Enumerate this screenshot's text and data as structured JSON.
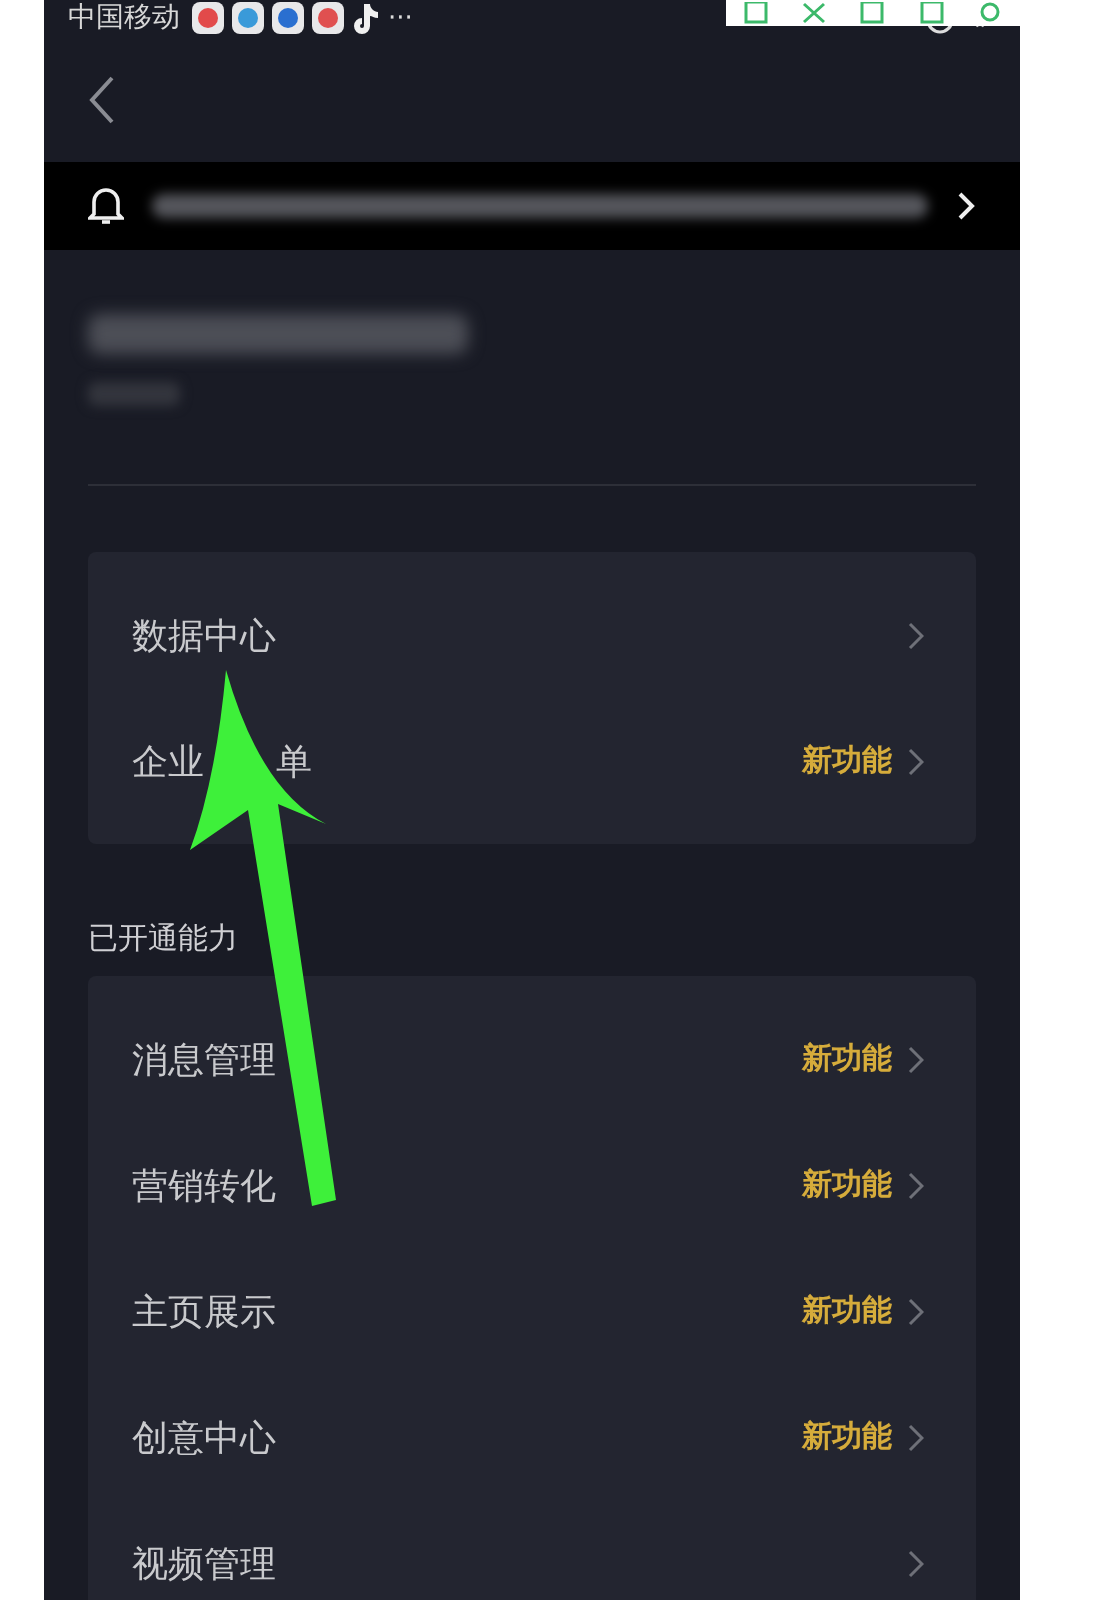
{
  "status_bar": {
    "carrier": "中国移动",
    "more": "···"
  },
  "section_title": "已开通能力",
  "primary_items": [
    {
      "label": "数据中心"
    },
    {
      "label_parts": [
        "企业",
        "单"
      ],
      "badge": "新功能"
    }
  ],
  "capabilities": [
    {
      "label": "消息管理",
      "badge": "新功能"
    },
    {
      "label": "营销转化",
      "badge": "新功能"
    },
    {
      "label": "主页展示",
      "badge": "新功能"
    },
    {
      "label": "创意中心",
      "badge": "新功能"
    },
    {
      "label": "视频管理"
    }
  ]
}
